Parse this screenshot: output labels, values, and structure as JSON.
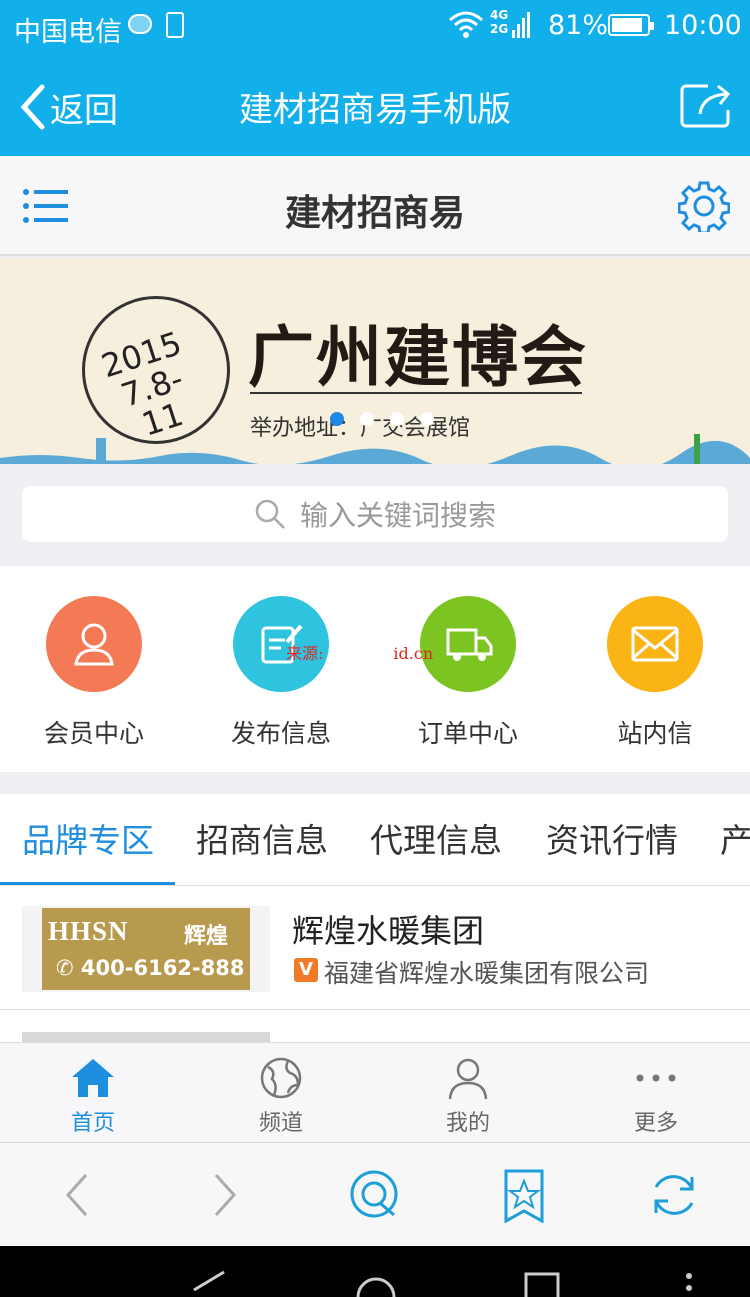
{
  "status_bar": {
    "carrier": "中国电信",
    "network": "4G\n2G",
    "battery_percent": "81%",
    "time": "10:00"
  },
  "title_bar": {
    "back_label": "返回",
    "title": "建材招商易手机版"
  },
  "site_header": {
    "title": "建材招商易"
  },
  "banner": {
    "year": "2015",
    "dates": "7.8-11",
    "headline": "广州建博会",
    "venue": "举办地址：广交会展馆",
    "slide_count": 4,
    "active_slide": 1
  },
  "search": {
    "placeholder": "输入关键词搜索"
  },
  "quick_actions": [
    {
      "label": "会员中心",
      "color": "#f47a55"
    },
    {
      "label": "发布信息",
      "color": "#2ec4e0"
    },
    {
      "label": "订单中心",
      "color": "#7cc421"
    },
    {
      "label": "站内信",
      "color": "#fbb416"
    }
  ],
  "tabs": [
    "品牌专区",
    "招商信息",
    "代理信息",
    "资讯行情",
    "产"
  ],
  "active_tab": 0,
  "list_items": [
    {
      "logo_text": "HHSN",
      "logo_text_cn": "辉煌",
      "logo_phone": "400-6162-888",
      "name": "辉煌水暖集团",
      "badge": "V",
      "company": "福建省辉煌水暖集团有限公司"
    }
  ],
  "bottom_nav": [
    {
      "label": "首页",
      "icon": "home-icon",
      "active": true
    },
    {
      "label": "频道",
      "icon": "globe-icon",
      "active": false
    },
    {
      "label": "我的",
      "icon": "user-icon",
      "active": false
    },
    {
      "label": "更多",
      "icon": "more-icon",
      "active": false
    }
  ],
  "watermark": {
    "left": "来源:",
    "right": "id.cn"
  },
  "colors": {
    "brand_blue": "#12b0ea",
    "accent": "#1e8ede",
    "badge_orange": "#f07a28",
    "logo_gold": "#b89a4f"
  }
}
